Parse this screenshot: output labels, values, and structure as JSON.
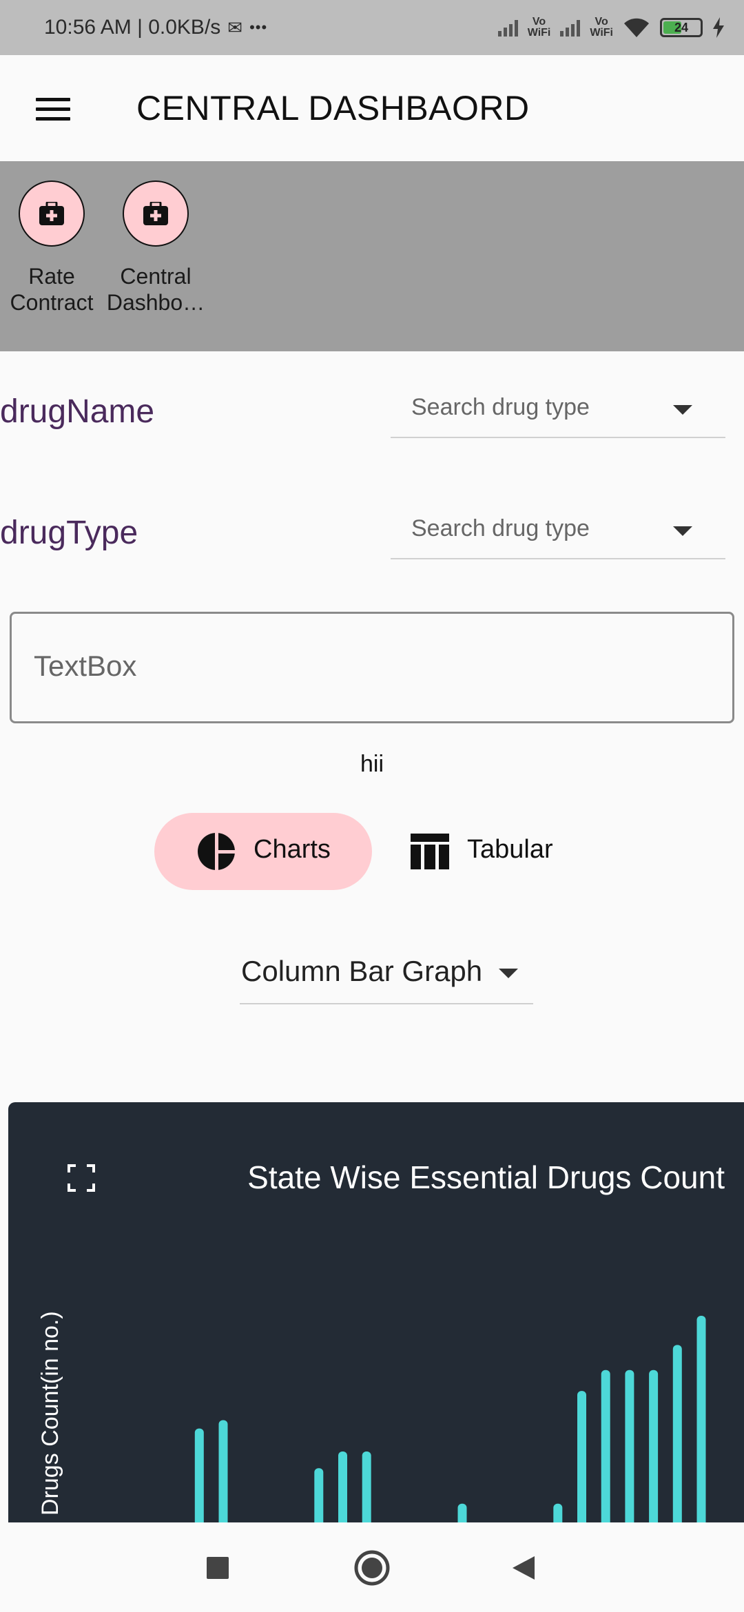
{
  "status_bar": {
    "time_net": "10:56 AM | 0.0KB/s",
    "mail_icon": "gmail-icon",
    "more": "•••",
    "vowifi_1": "Vo\nWiFi",
    "vowifi_2": "Vo\nWiFi",
    "battery_level": "24"
  },
  "app_bar": {
    "title": "CENTRAL DASHBAORD"
  },
  "shortcuts": [
    {
      "label": "Rate\nContract",
      "icon": "medical-bag-icon"
    },
    {
      "label": "Central\nDashbo…",
      "icon": "medical-bag-icon"
    }
  ],
  "filters": {
    "drug_name_label": "drugName",
    "drug_name_placeholder": "Search drug type",
    "drug_type_label": "drugType",
    "drug_type_placeholder": "Search drug type"
  },
  "textbox": {
    "placeholder": "TextBox"
  },
  "hii_text": "hii",
  "view_toggle": {
    "charts_label": "Charts",
    "tabular_label": "Tabular",
    "selected": "Charts"
  },
  "graph_type": {
    "selected": "Column Bar Graph"
  },
  "colors": {
    "accent_pink": "#ffcdd2",
    "label_purple": "#4a2a5c",
    "chart_bg": "#232b35",
    "bar_color": "#4dd8d8"
  },
  "chart_data": {
    "type": "bar",
    "title": "State Wise Essential Drugs Count",
    "ylabel": "Drugs Count(in no.)",
    "xlabel": "",
    "grid": false,
    "series": [
      {
        "values": [
          0,
          0,
          0,
          0,
          45,
          49,
          0,
          0,
          0,
          26,
          34,
          34,
          0,
          0,
          0,
          9,
          0,
          0,
          0,
          9,
          63,
          73,
          73,
          73,
          85,
          99
        ]
      }
    ]
  }
}
